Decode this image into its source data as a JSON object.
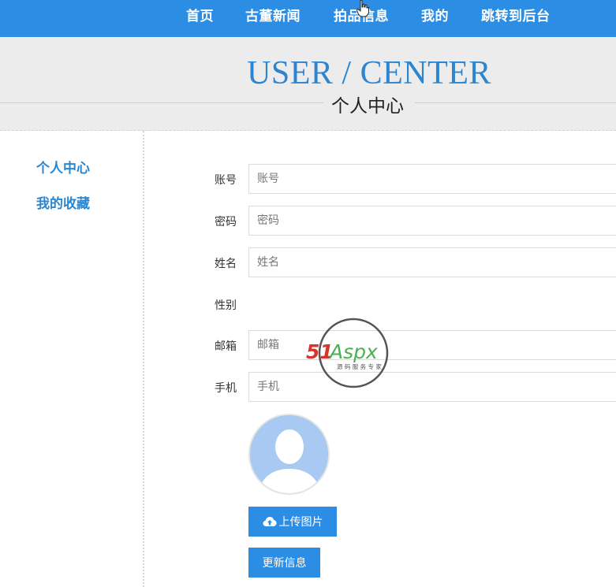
{
  "nav": {
    "items": [
      "首页",
      "古董新闻",
      "拍品信息",
      "我的",
      "跳转到后台"
    ]
  },
  "banner": {
    "title": "USER / CENTER",
    "subtitle": "个人中心"
  },
  "sidebar": {
    "items": [
      "个人中心",
      "我的收藏"
    ]
  },
  "form": {
    "account": {
      "label": "账号",
      "placeholder": "账号"
    },
    "password": {
      "label": "密码",
      "placeholder": "密码"
    },
    "name": {
      "label": "姓名",
      "placeholder": "姓名"
    },
    "gender": {
      "label": "性别"
    },
    "email": {
      "label": "邮箱",
      "placeholder": "邮箱"
    },
    "phone": {
      "label": "手机",
      "placeholder": "手机"
    },
    "upload_label": "上传图片",
    "update_label": "更新信息"
  },
  "watermark": {
    "brand_a": "51",
    "brand_b": "Aspx",
    "tagline": "源 码 服 务 专 家"
  },
  "colors": {
    "primary": "#2c8de4",
    "banner_bg": "#ececec",
    "link": "#2a86d1",
    "watermark_red": "#d9342b",
    "watermark_green": "#4caf50"
  },
  "icons": {
    "upload": "cloud-upload-icon",
    "avatar": "user-avatar-icon",
    "cursor": "hand-pointer-icon"
  }
}
